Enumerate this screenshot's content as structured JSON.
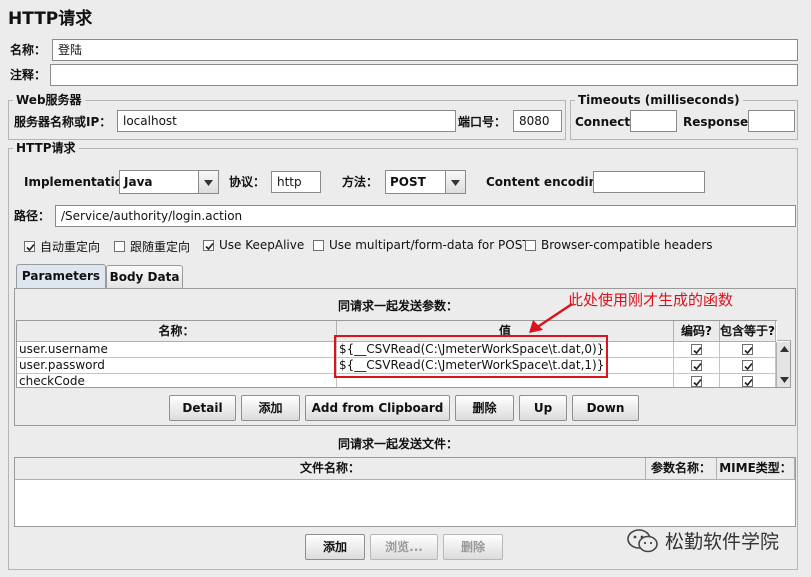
{
  "title": "HTTP请求",
  "name_label": "名称：",
  "name_value": "登陆",
  "comment_label": "注释：",
  "comment_value": "",
  "web_server": {
    "legend": "Web服务器",
    "server_label": "服务器名称或IP：",
    "server_value": "localhost",
    "port_label": "端口号：",
    "port_value": "8080"
  },
  "timeouts": {
    "legend": "Timeouts (milliseconds)",
    "connect_label": "Connect:",
    "connect_value": "",
    "response_label": "Response:",
    "response_value": ""
  },
  "http_request": {
    "legend": "HTTP请求",
    "implementation_label": "Implementation:",
    "implementation_value": "Java",
    "protocol_label": "协议：",
    "protocol_value": "http",
    "method_label": "方法：",
    "method_value": "POST",
    "encoding_label": "Content encoding:",
    "encoding_value": "",
    "path_label": "路径：",
    "path_value": "/Service/authority/login.action"
  },
  "options": [
    {
      "label": "自动重定向",
      "checked": true
    },
    {
      "label": "跟随重定向",
      "checked": false
    },
    {
      "label": "Use KeepAlive",
      "checked": true
    },
    {
      "label": "Use multipart/form-data for POST",
      "checked": false
    },
    {
      "label": "Browser-compatible headers",
      "checked": false
    }
  ],
  "tabs": [
    {
      "label": "Parameters",
      "active": true
    },
    {
      "label": "Body Data",
      "active": false
    }
  ],
  "params": {
    "caption": "同请求一起发送参数：",
    "annotation": "此处使用刚才生成的函数",
    "columns": [
      "名称：",
      "值",
      "编码?",
      "包含等于?"
    ],
    "rows": [
      {
        "name": "user.username",
        "value": "${__CSVRead(C:\\JmeterWorkSpace\\t.dat,0)}",
        "encode": true,
        "include_equals": true
      },
      {
        "name": "user.password",
        "value": "${__CSVRead(C:\\JmeterWorkSpace\\t.dat,1)}",
        "encode": true,
        "include_equals": true
      },
      {
        "name": "checkCode",
        "value": "",
        "encode": true,
        "include_equals": true
      }
    ]
  },
  "param_buttons": [
    "Detail",
    "添加",
    "Add from Clipboard",
    "删除",
    "Up",
    "Down"
  ],
  "files": {
    "caption": "同请求一起发送文件：",
    "columns": [
      "文件名称：",
      "参数名称：",
      "MIME类型："
    ]
  },
  "file_buttons": [
    "添加",
    "浏览...",
    "删除"
  ],
  "watermark": "松勤软件学院",
  "colors": {
    "highlight": "#d9141e",
    "background": "#ececec"
  }
}
